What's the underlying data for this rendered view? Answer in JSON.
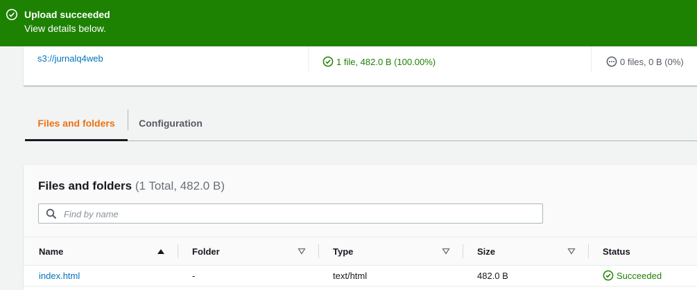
{
  "banner": {
    "title": "Upload succeeded",
    "subtitle": "View details below.",
    "icon": "check-circle-icon",
    "color": "#1d8102"
  },
  "summary": {
    "destination": "s3://jurnalq4web",
    "succeeded": "1 file, 482.0 B (100.00%)",
    "failed": "0 files, 0 B (0%)"
  },
  "tabs": [
    {
      "label": "Files and folders",
      "active": true
    },
    {
      "label": "Configuration",
      "active": false
    }
  ],
  "files_panel": {
    "title": "Files and folders",
    "count": "(1 Total, 482.0 B)",
    "search_placeholder": "Find by name",
    "columns": [
      {
        "label": "Name",
        "sort": "ascending"
      },
      {
        "label": "Folder",
        "sort": "none"
      },
      {
        "label": "Type",
        "sort": "none"
      },
      {
        "label": "Size",
        "sort": "none"
      },
      {
        "label": "Status",
        "sort": "none"
      }
    ],
    "rows": [
      {
        "name": "index.html",
        "folder": "-",
        "type": "text/html",
        "size": "482.0 B",
        "status": "Succeeded"
      }
    ]
  },
  "colors": {
    "accent_tab": "#ec7211",
    "link": "#0073bb",
    "success": "#1d8102"
  }
}
